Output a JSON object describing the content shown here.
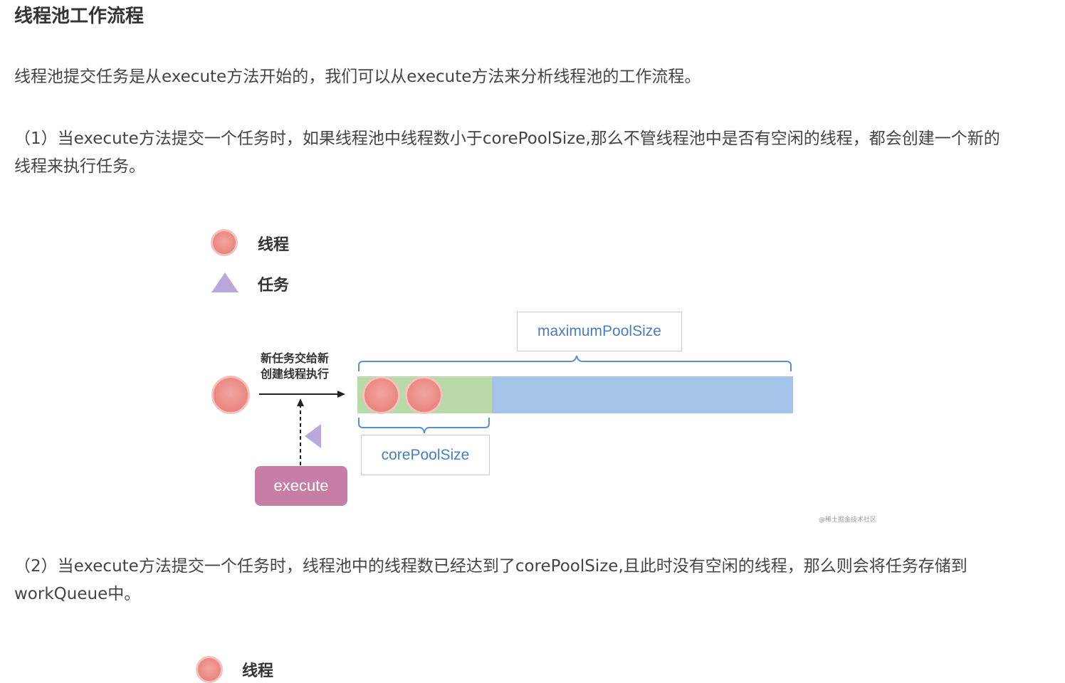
{
  "article": {
    "heading": "线程池工作流程",
    "intro": "线程池提交任务是从execute方法开始的，我们可以从execute方法来分析线程池的工作流程。",
    "step1_line1": "（1）当execute方法提交一个任务时，如果线程池中线程数小于corePoolSize,那么不管线程池中是否有空闲的线程，都会创建一个新的",
    "step1_line2": "线程来执行任务。",
    "step2_line1": "（2）当execute方法提交一个任务时，线程池中的线程数已经达到了corePoolSize,且此时没有空闲的线程，那么则会将任务存储到",
    "step2_line2": "workQueue中。"
  },
  "figure": {
    "legend_thread": "线程",
    "legend_task": "任务",
    "arrow_label_line1": "新任务交给新",
    "arrow_label_line2": "创建线程执行",
    "maximum_label": "maximumPoolSize",
    "core_label": "corePoolSize",
    "execute_label": "execute",
    "watermark": "@稀土掘金技术社区",
    "core_threads": 2,
    "colors": {
      "thread": "#ec8c86",
      "task": "#b8a8dc",
      "core_region": "#b8d9a8",
      "max_region": "#a3c4e8",
      "brace": "#5b8fd0",
      "execute": "#c67ea6"
    }
  },
  "next_figure": {
    "legend_thread": "线程"
  }
}
